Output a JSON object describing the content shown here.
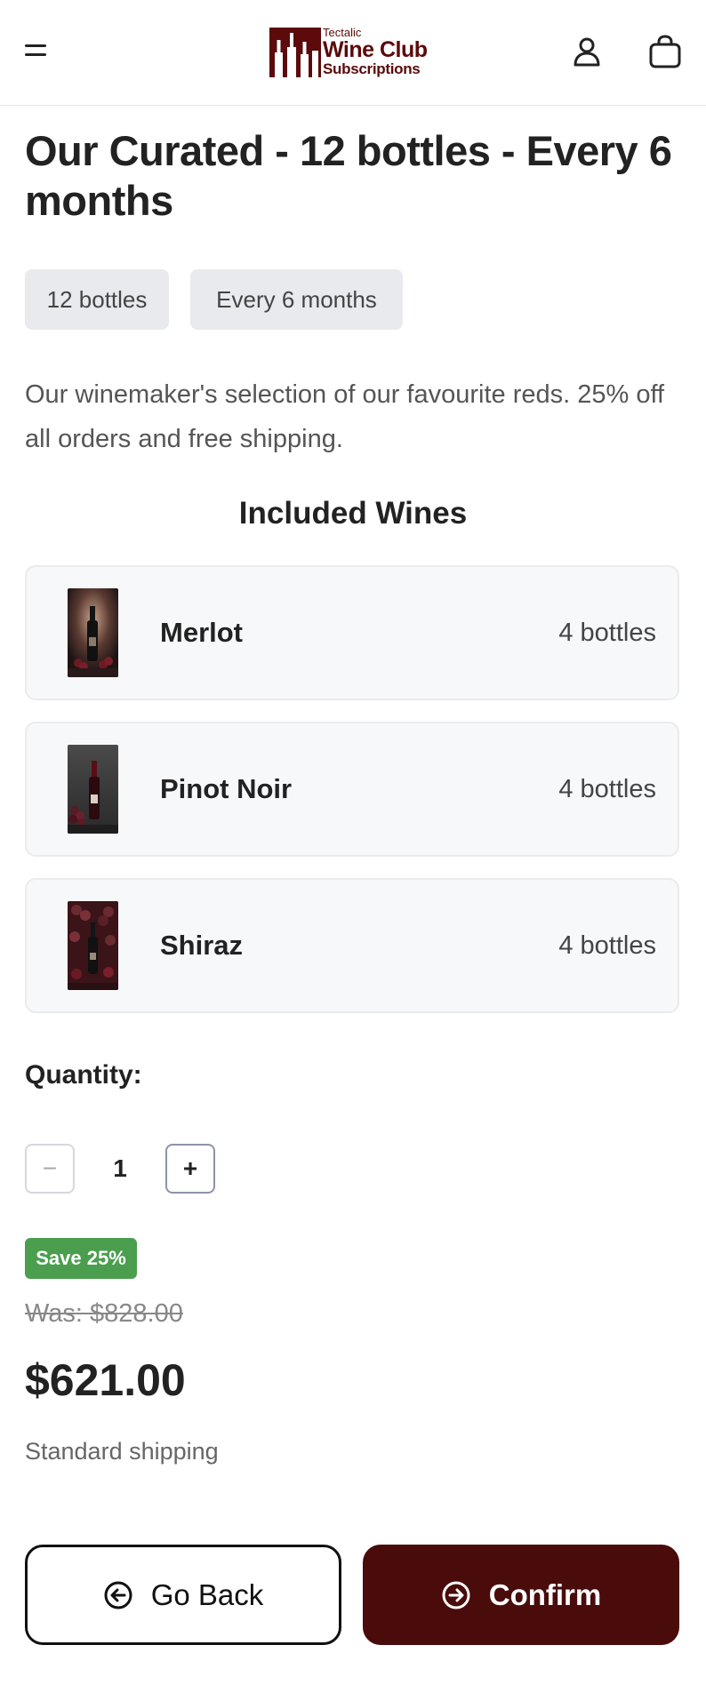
{
  "header": {
    "menu_icon": "hamburger-menu-icon",
    "logo": {
      "small": "Tectalic",
      "big": "Wine Club",
      "sub": "Subscriptions",
      "color": "#5c0a0a"
    },
    "user_icon": "user-account-icon",
    "cart_icon": "shopping-bag-icon"
  },
  "product": {
    "title": "Our Curated - 12 bottles - Every 6 months",
    "chips": [
      "12 bottles",
      "Every 6 months"
    ],
    "description": "Our winemaker's selection of our favourite reds. 25% off all orders and free shipping."
  },
  "included": {
    "heading": "Included Wines",
    "wines": [
      {
        "name": "Merlot",
        "quantity": "4 bottles"
      },
      {
        "name": "Pinot Noir",
        "quantity": "4 bottles"
      },
      {
        "name": "Shiraz",
        "quantity": "4 bottles"
      }
    ]
  },
  "quantity": {
    "label": "Quantity:",
    "minus": "−",
    "value": "1",
    "plus": "+"
  },
  "pricing": {
    "badge": "Save 25%",
    "was": "Was: $828.00",
    "price": "$621.00",
    "shipping": "Standard shipping",
    "badge_color": "#4a9e4e"
  },
  "actions": {
    "back_label": "Go Back",
    "back_icon": "arrow-left-circle-icon",
    "confirm_label": "Confirm",
    "confirm_icon": "arrow-right-circle-icon",
    "confirm_color": "#4a0b0b"
  }
}
